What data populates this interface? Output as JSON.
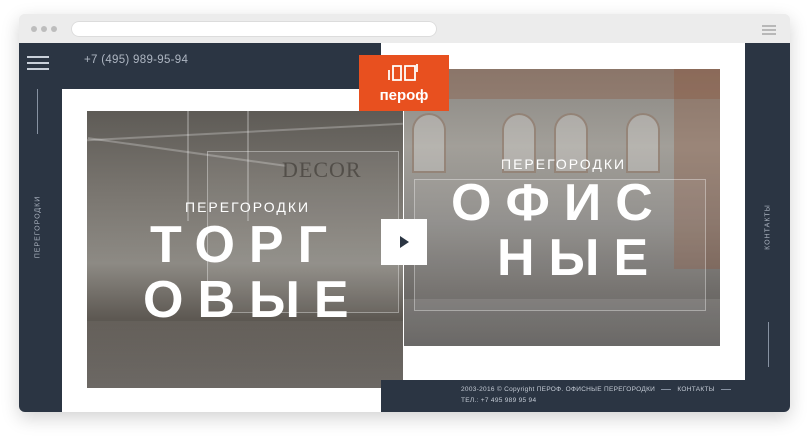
{
  "header": {
    "phone": "+7 (495) 989-95-94",
    "logo_text": "пероф"
  },
  "sidebar_left": {
    "vertical_label": "ПЕРЕГОРОДКИ"
  },
  "sidebar_right": {
    "vertical_label": "КОНТАКТЫ"
  },
  "panels": {
    "retail": {
      "caption": "ПЕРЕГОРОДКИ",
      "title_line1": "ТОРГ",
      "title_line2": "ОВЫЕ",
      "sign": "DECOR"
    },
    "office": {
      "caption": "ПЕРЕГОРОДКИ",
      "title_line1": "ОФИС",
      "title_line2": "НЫЕ"
    }
  },
  "footer": {
    "copyright": "2003-2016 © Copyright ПЕРОФ. ОФИСНЫЕ ПЕРЕГОРОДКИ",
    "contacts_link": "КОНТАКТЫ",
    "tel": "ТЕЛ.: +7 495 989 95 94"
  },
  "colors": {
    "dark": "#2b3543",
    "accent": "#e8501f",
    "white": "#ffffff"
  },
  "icons": [
    "hamburger-icon",
    "play-icon",
    "logo-mark-icon"
  ]
}
